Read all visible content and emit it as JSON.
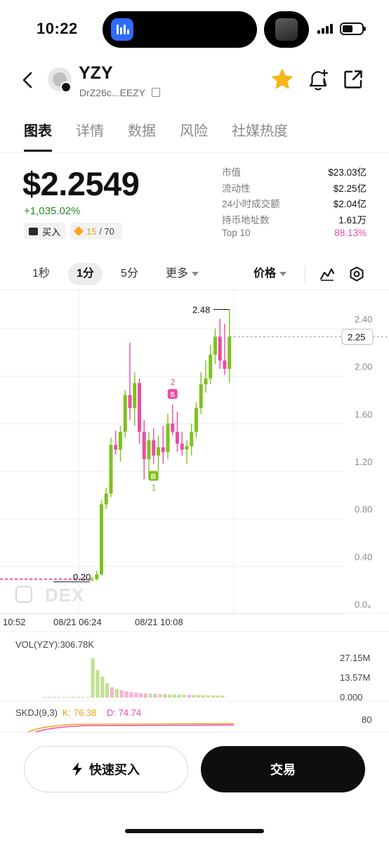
{
  "status": {
    "time": "10:22"
  },
  "header": {
    "token": "YZY",
    "address": "DrZ26c...EEZY"
  },
  "tabs": [
    "图表",
    "详情",
    "数据",
    "风险",
    "社媒热度"
  ],
  "price": {
    "value": "$2.2549",
    "change": "+1,035.02%",
    "buy_label": "买入",
    "score_value": "15",
    "score_total": "/ 70"
  },
  "stats": [
    {
      "label": "市值",
      "value": "$23.03亿"
    },
    {
      "label": "流动性",
      "value": "$2.25亿"
    },
    {
      "label": "24小时成交额",
      "value": "$2.04亿"
    },
    {
      "label": "持币地址数",
      "value": "1.61万"
    },
    {
      "label": "Top 10",
      "value": "88.13%",
      "color": "#e24aa7"
    }
  ],
  "intervals": {
    "items": [
      "1秒",
      "1分",
      "5分",
      "更多"
    ],
    "active": "1分",
    "mode": "价格"
  },
  "chart_data": {
    "type": "candlestick",
    "price_axis": {
      "ticks": [
        "2.40",
        "2.00",
        "1.60",
        "1.20",
        "0.80",
        "0.40",
        "0.0₄"
      ],
      "range": [
        0,
        2.4
      ]
    },
    "current_price_tag": "2.25",
    "high_label": "2.48",
    "low_label": "0.20",
    "time_labels": [
      "10:52",
      "08/21 06:24",
      "08/21 10:08"
    ],
    "markers": [
      {
        "letter": "B",
        "number": "1",
        "candle": 13,
        "color": "#7ec11d"
      },
      {
        "letter": "S",
        "number": "2",
        "candle": 17,
        "color": "#ee4ba5"
      }
    ],
    "candles": [
      {
        "o": 0.21,
        "h": 0.23,
        "l": 0.2,
        "c": 0.21
      },
      {
        "o": 0.21,
        "h": 0.28,
        "l": 0.2,
        "c": 0.25
      },
      {
        "o": 0.25,
        "h": 0.88,
        "l": 0.24,
        "c": 0.84
      },
      {
        "o": 0.84,
        "h": 0.98,
        "l": 0.8,
        "c": 0.93
      },
      {
        "o": 0.93,
        "h": 1.4,
        "l": 0.9,
        "c": 1.34
      },
      {
        "o": 1.34,
        "h": 1.46,
        "l": 1.26,
        "c": 1.3
      },
      {
        "o": 1.3,
        "h": 1.5,
        "l": 1.2,
        "c": 1.45
      },
      {
        "o": 1.45,
        "h": 1.8,
        "l": 1.4,
        "c": 1.76
      },
      {
        "o": 1.76,
        "h": 2.2,
        "l": 1.55,
        "c": 1.65
      },
      {
        "o": 1.65,
        "h": 1.95,
        "l": 1.5,
        "c": 1.86
      },
      {
        "o": 1.86,
        "h": 1.9,
        "l": 1.35,
        "c": 1.45
      },
      {
        "o": 1.45,
        "h": 1.55,
        "l": 1.05,
        "c": 1.22
      },
      {
        "o": 1.22,
        "h": 1.45,
        "l": 1.05,
        "c": 1.38
      },
      {
        "o": 1.38,
        "h": 1.48,
        "l": 1.18,
        "c": 1.25
      },
      {
        "o": 1.25,
        "h": 1.42,
        "l": 1.12,
        "c": 1.32
      },
      {
        "o": 1.32,
        "h": 1.5,
        "l": 1.18,
        "c": 1.28
      },
      {
        "o": 1.28,
        "h": 1.6,
        "l": 1.22,
        "c": 1.52
      },
      {
        "o": 1.52,
        "h": 1.68,
        "l": 1.42,
        "c": 1.45
      },
      {
        "o": 1.45,
        "h": 1.62,
        "l": 1.28,
        "c": 1.35
      },
      {
        "o": 1.35,
        "h": 1.45,
        "l": 1.25,
        "c": 1.3
      },
      {
        "o": 1.3,
        "h": 1.38,
        "l": 1.18,
        "c": 1.33
      },
      {
        "o": 1.33,
        "h": 1.52,
        "l": 1.25,
        "c": 1.45
      },
      {
        "o": 1.45,
        "h": 1.7,
        "l": 1.4,
        "c": 1.65
      },
      {
        "o": 1.65,
        "h": 1.95,
        "l": 1.6,
        "c": 1.85
      },
      {
        "o": 1.85,
        "h": 2.05,
        "l": 1.78,
        "c": 1.9
      },
      {
        "o": 1.9,
        "h": 2.18,
        "l": 1.85,
        "c": 2.1
      },
      {
        "o": 2.1,
        "h": 2.32,
        "l": 2.02,
        "c": 2.25
      },
      {
        "o": 2.25,
        "h": 2.4,
        "l": 1.98,
        "c": 2.05
      },
      {
        "o": 2.05,
        "h": 2.36,
        "l": 1.93,
        "c": 1.98
      },
      {
        "o": 1.98,
        "h": 2.48,
        "l": 1.86,
        "c": 2.25
      }
    ],
    "volume": {
      "label": "VOL(YZY):306.78K",
      "ticks": [
        "27.15M",
        "13.57M",
        "0.000"
      ],
      "max": 27.15,
      "values": [
        0.02,
        0.03,
        0.05,
        0.08,
        0.1,
        0.12,
        0.2,
        0.3,
        0.4,
        0.5,
        27.15,
        19.0,
        14.5,
        10.0,
        7.2,
        5.8,
        5.1,
        4.4,
        3.9,
        3.4,
        3.0,
        2.8,
        2.7,
        2.6,
        2.5,
        2.4,
        2.3,
        2.2,
        2.1,
        2.0,
        1.9,
        1.8,
        1.7,
        1.6,
        1.6,
        1.5,
        1.5,
        1.4
      ],
      "colors": [
        "g",
        "g",
        "g",
        "g",
        "g",
        "g",
        "g",
        "g",
        "g",
        "g",
        "g",
        "g",
        "g",
        "g",
        "p",
        "g",
        "p",
        "p",
        "p",
        "p",
        "p",
        "p",
        "g",
        "p",
        "g",
        "p",
        "g",
        "g",
        "g",
        "g",
        "p",
        "g",
        "g",
        "g",
        "g",
        "g",
        "g",
        "g"
      ]
    },
    "indicator": {
      "name": "SKDJ(9,3)",
      "k_label": "K: 76.38",
      "d_label": "D: 74.74",
      "tick": "80"
    }
  },
  "actions": {
    "quick_buy": "快速买入",
    "trade": "交易"
  },
  "watermark": "DEX",
  "colors": {
    "up": "#7ec11d",
    "down": "#ee4ba5",
    "vol_up": "#c2e094",
    "vol_down": "#f7b3d6",
    "grid": "#eeeeee",
    "axis_text": "#8a8a8a",
    "current_line": "#999999"
  }
}
